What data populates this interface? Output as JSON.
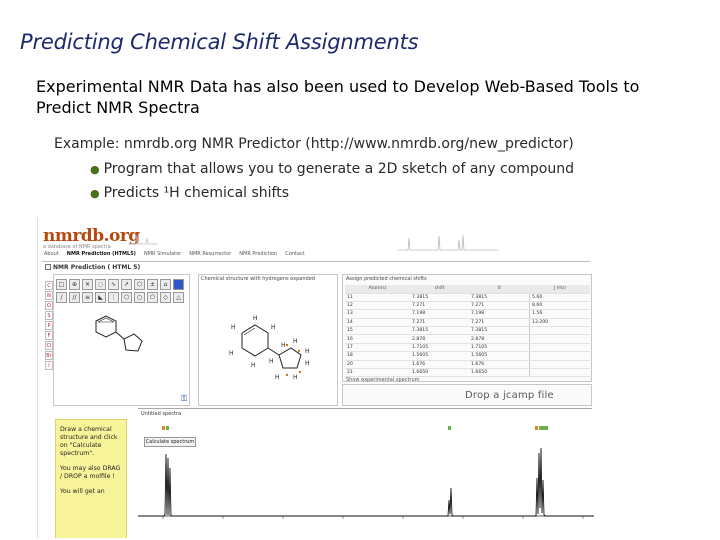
{
  "slide": {
    "title": "Predicting Chemical Shift Assignments",
    "lead": "Experimental NMR Data has also been used to Develop Web-Based Tools to Predict NMR Spectra",
    "example": "Example: nmrdb.org NMR Predictor (http://www.nmrdb.org/new_predictor)",
    "bullets": [
      "Program that allows you to generate a 2D sketch of any compound",
      "Predicts ¹H chemical shifts"
    ],
    "colors": {
      "title": "#1d2a6b",
      "bullet": "#4a6f1a"
    }
  },
  "screenshot": {
    "logo": "nmrdb.org",
    "logo_sub": "a database of NMR spectra",
    "nav": [
      "About",
      "NMR Prediction (HTML5)",
      "NMR Simulator",
      "NMR Resurrector",
      "NMR Prediction",
      "Contact"
    ],
    "page_heading": "NMR Prediction ( HTML 5)",
    "editor": {
      "elements": [
        "C",
        "N",
        "O",
        "S",
        "P",
        "F",
        "Cl",
        "Br",
        "I"
      ],
      "calc_button": "Calculate spectrum",
      "corner_icon": "key-icon"
    },
    "molecule_panel_title": "Chemical structure with hydrogens expanded",
    "table_panel_title": "Assign predicted chemical shifts",
    "table": {
      "headers": [
        "Atom(s)",
        "shift",
        "δ",
        "J (Hz)"
      ],
      "rows": [
        [
          "11",
          "7.3815",
          "7.3815",
          "5.60"
        ],
        [
          "12",
          "7.271",
          "7.271",
          "8.60"
        ],
        [
          "13",
          "7.198",
          "7.198",
          "1.56"
        ],
        [
          "14",
          "7.271",
          "7.271",
          "13.200"
        ],
        [
          "15",
          "7.3815",
          "7.3815",
          ""
        ],
        [
          "16",
          "2.878",
          "2.878",
          ""
        ],
        [
          "17",
          "1.7105",
          "1.7105",
          ""
        ],
        [
          "18",
          "1.5605",
          "1.5605",
          ""
        ],
        [
          "20",
          "1.676",
          "1.676",
          ""
        ],
        [
          "21",
          "1.6650",
          "1.6650",
          ""
        ]
      ]
    },
    "drop_label": "Drop a jcamp file",
    "drop_head": "Show experimental spectrum",
    "spectrum_title": "Untitled spectra",
    "instructions": [
      "Draw a chemical structure and click on \"Calculate spectrum\".",
      "You may also DRAG / DROP a molfile !",
      "You will get an"
    ]
  }
}
